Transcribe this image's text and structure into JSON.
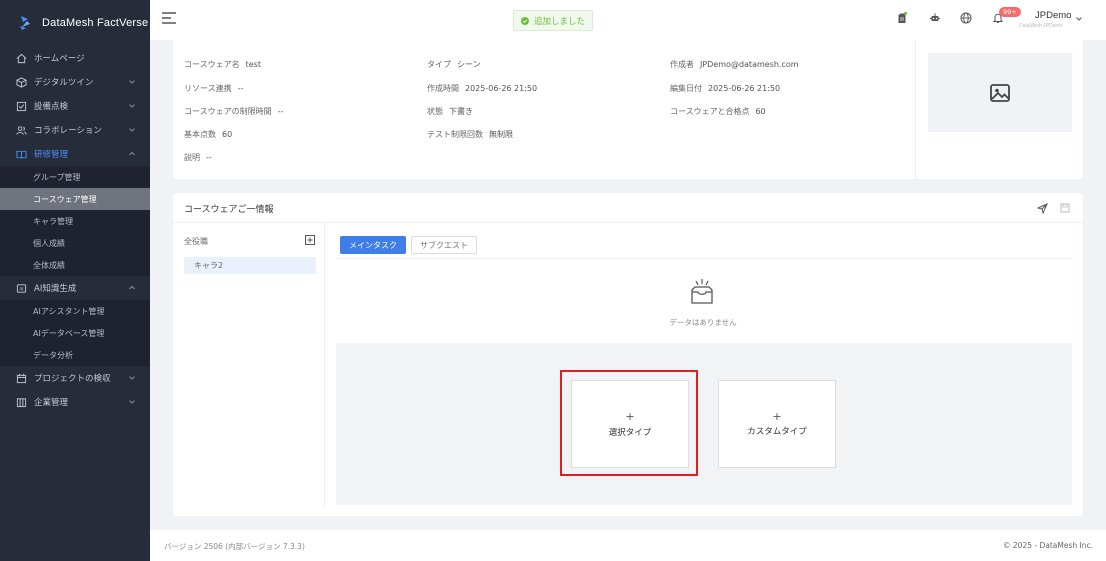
{
  "brand": {
    "name": "DataMesh FactVerse"
  },
  "sidebar": {
    "items": [
      {
        "label": "ホームページ",
        "icon": "home-icon"
      },
      {
        "label": "デジタルツイン",
        "icon": "cube-icon"
      },
      {
        "label": "設備点検",
        "icon": "checklist-icon"
      },
      {
        "label": "コラボレーション",
        "icon": "users-icon"
      },
      {
        "label": "研修管理",
        "icon": "book-icon"
      },
      {
        "label": "AI知識生成",
        "icon": "ai-icon"
      },
      {
        "label": "プロジェクトの検収",
        "icon": "calendar-icon"
      },
      {
        "label": "企業管理",
        "icon": "building-icon"
      }
    ],
    "training_sub": [
      "グループ管理",
      "コースウェア管理",
      "キャラ管理",
      "個人成績",
      "全体成績"
    ],
    "ai_sub": [
      "AIアシスタント管理",
      "AIデータベース管理",
      "データ分析"
    ]
  },
  "header": {
    "toast": "追加しました",
    "badge": "99+",
    "user_name": "JPDemo",
    "user_sub": "DataMesh JPDemo"
  },
  "info": {
    "name_label": "コースウェア名",
    "name_value": "test",
    "type_label": "タイプ",
    "type_value": "シーン",
    "author_label": "作成者",
    "author_value": "JPDemo@datamesh.com",
    "resource_label": "リソース連携",
    "resource_value": "--",
    "created_label": "作成時間",
    "created_value": "2025-06-26 21:50",
    "edited_label": "編集日付",
    "edited_value": "2025-06-26 21:50",
    "timelimit_label": "コースウェアの制限時間",
    "timelimit_value": "--",
    "status_label": "状態",
    "status_value": "下書き",
    "pass_label": "コースウェアと合格点",
    "pass_value": "60",
    "base_label": "基本点数",
    "base_value": "60",
    "attempts_label": "テスト制限回数",
    "attempts_value": "無制限",
    "desc_label": "説明",
    "desc_value": "--"
  },
  "detail": {
    "title": "コースウェアご一情報",
    "roles_header": "全役職",
    "role_item": "キャラ2",
    "tab_main": "メインタスク",
    "tab_sub": "サブクエスト",
    "empty_text": "データはありません",
    "select_plus": "+",
    "select_label": "選択タイプ",
    "custom_plus": "+",
    "custom_label": "カスタムタイプ"
  },
  "footer": {
    "version": "バージョン 2506 (内部バージョン 7.3.3)",
    "copyright": "© 2025 - DataMesh Inc."
  },
  "colors": {
    "primary": "#3f7ee8",
    "sidebar_bg": "#272c3a",
    "highlight": "#e02020",
    "success": "#67c23a"
  }
}
